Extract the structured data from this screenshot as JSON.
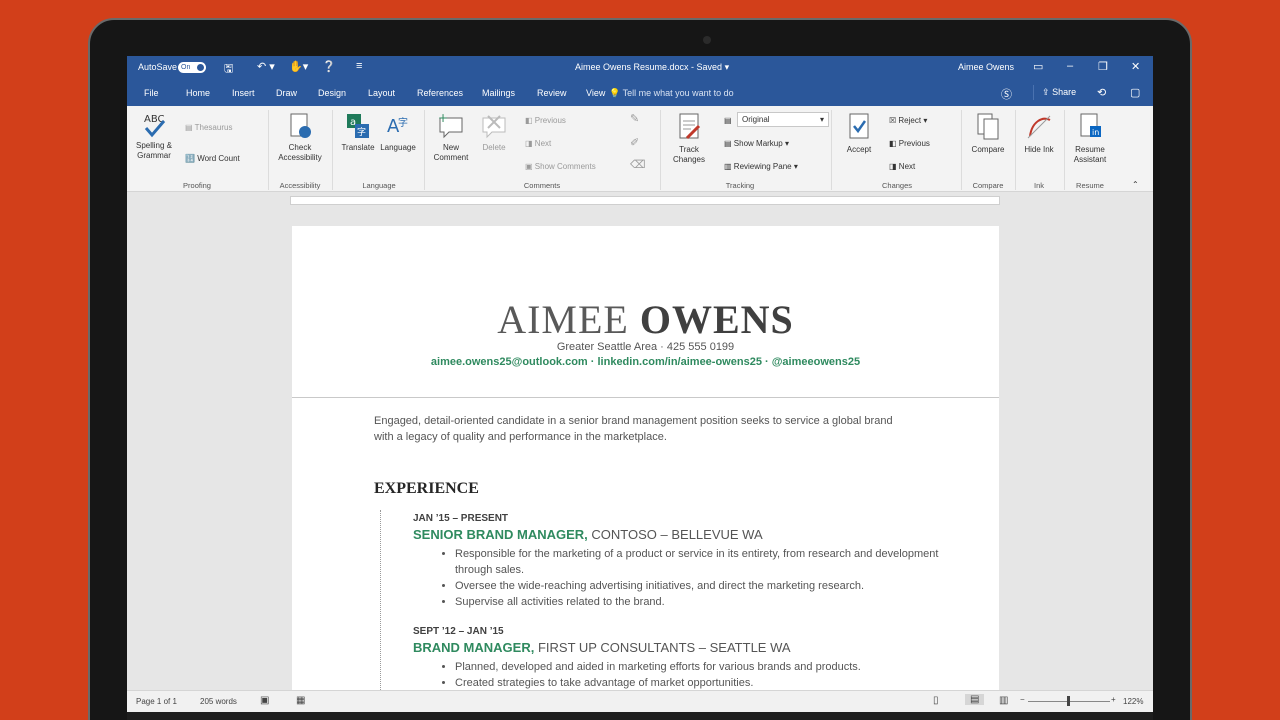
{
  "window": {
    "autosave_label": "AutoSave",
    "autosave_state": "On",
    "doc_title": "Aimee Owens Resume.docx - Saved ▾",
    "user": "Aimee Owens"
  },
  "tabs": [
    "File",
    "Home",
    "Insert",
    "Draw",
    "Design",
    "Layout",
    "References",
    "Mailings",
    "Review",
    "View"
  ],
  "tell_me": "Tell me what you want to do",
  "share_label": "Share",
  "ribbon": {
    "proofing": {
      "spelling": "Spelling & Grammar",
      "thesaurus": "Thesaurus",
      "word_count": "Word Count",
      "group": "Proofing"
    },
    "accessibility": {
      "check": "Check Accessibility",
      "group": "Accessibility"
    },
    "language": {
      "translate": "Translate",
      "language": "Language",
      "group": "Language"
    },
    "comments": {
      "new": "New Comment",
      "delete": "Delete",
      "previous": "Previous",
      "next": "Next",
      "show": "Show Comments",
      "group": "Comments"
    },
    "tracking": {
      "track": "Track Changes",
      "markup_view": "Original",
      "show_markup": "Show Markup",
      "reviewing_pane": "Reviewing Pane",
      "group": "Tracking"
    },
    "changes": {
      "accept": "Accept",
      "reject": "Reject",
      "previous": "Previous",
      "next": "Next",
      "group": "Changes"
    },
    "compare": {
      "compare": "Compare",
      "group": "Compare"
    },
    "ink": {
      "hide": "Hide Ink",
      "group": "Ink"
    },
    "resume": {
      "assistant": "Resume Assistant",
      "group": "Resume"
    }
  },
  "document": {
    "name_first": "AIMEE ",
    "name_last": "OWENS",
    "location": "Greater Seattle Area  · 425 555 0199",
    "links": "aimee.owens25@outlook.com · linkedin.com/in/aimee-owens25 · @aimeeowens25",
    "summary": "Engaged, detail-oriented candidate in a senior brand management position seeks to service a global brand with a legacy of quality and performance in the marketplace.",
    "section_experience": "EXPERIENCE",
    "jobs": [
      {
        "dates": "JAN ’15 – PRESENT",
        "role": "SENIOR BRAND MANAGER,",
        "company": " CONTOSO – BELLEVUE WA",
        "bullets": [
          "Responsible for the marketing of a product or service in its entirety, from research and development through sales.",
          "Oversee the wide-reaching advertising initiatives, and direct the marketing research.",
          "Supervise all activities related to the brand."
        ]
      },
      {
        "dates": "SEPT ’12 – JAN ’15",
        "role": "BRAND MANAGER,",
        "company": " FIRST UP CONSULTANTS – SEATTLE WA",
        "bullets": [
          "Planned, developed and aided in marketing efforts for various brands and products.",
          "Created strategies to take advantage of market opportunities."
        ]
      }
    ]
  },
  "status": {
    "page": "Page 1 of 1",
    "words": "205 words",
    "zoom": "122%"
  }
}
